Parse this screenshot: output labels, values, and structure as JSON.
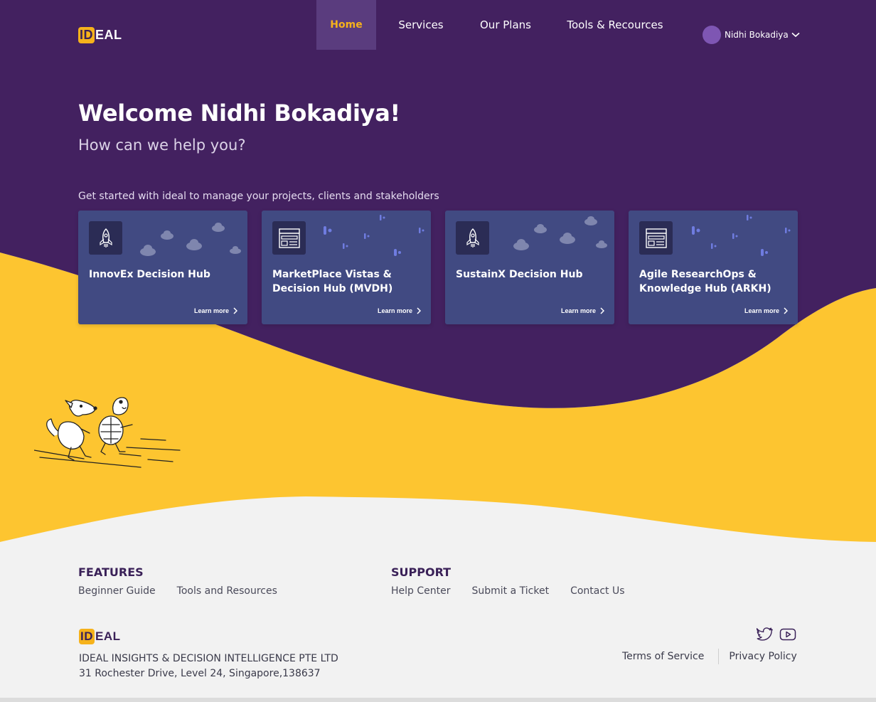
{
  "brand": {
    "logo_id": "ID",
    "logo_rest": "EAL",
    "accent": "#f6b21b",
    "primary": "#432160",
    "yellow": "#fdc530"
  },
  "nav": {
    "items": [
      {
        "label": "Home",
        "active": true
      },
      {
        "label": "Services"
      },
      {
        "label": "Our Plans"
      },
      {
        "label": "Tools & Recources"
      }
    ]
  },
  "user": {
    "name": "Nidhi Bokadiya",
    "chevron": "chevron-down-icon"
  },
  "hero": {
    "welcome": "Welcome Nidhi Bokadiya!",
    "subtitle": "How can we help you?",
    "prompt": "Get started with ideal to manage your projects, clients and stakeholders"
  },
  "cards": [
    {
      "title": "InnovEx Decision Hub",
      "icon": "rocket-icon",
      "learn": "Learn more"
    },
    {
      "title": "MarketPlace Vistas & Decision Hub (MVDH)",
      "icon": "layout-icon",
      "learn": "Learn more"
    },
    {
      "title": "SustainX Decision Hub",
      "icon": "rocket-icon",
      "learn": "Learn more"
    },
    {
      "title": "Agile  ResearchOps & Knowledge Hub (ARKH)",
      "icon": "layout-icon",
      "learn": "Learn more"
    }
  ],
  "footer": {
    "features": {
      "heading": "FEATURES",
      "links": [
        "Beginner Guide",
        "Tools and Resources"
      ]
    },
    "support": {
      "heading": "SUPPORT",
      "links": [
        "Help Center",
        "Submit a Ticket",
        "Contact Us"
      ]
    },
    "company": "IDEAL INSIGHTS & DECISION INTELLIGENCE PTE LTD",
    "address": "31 Rochester Drive, Level 24, Singapore,138637",
    "legal": [
      "Terms of Service",
      "Privacy Policy"
    ],
    "social": [
      "twitter-icon",
      "youtube-icon"
    ]
  }
}
